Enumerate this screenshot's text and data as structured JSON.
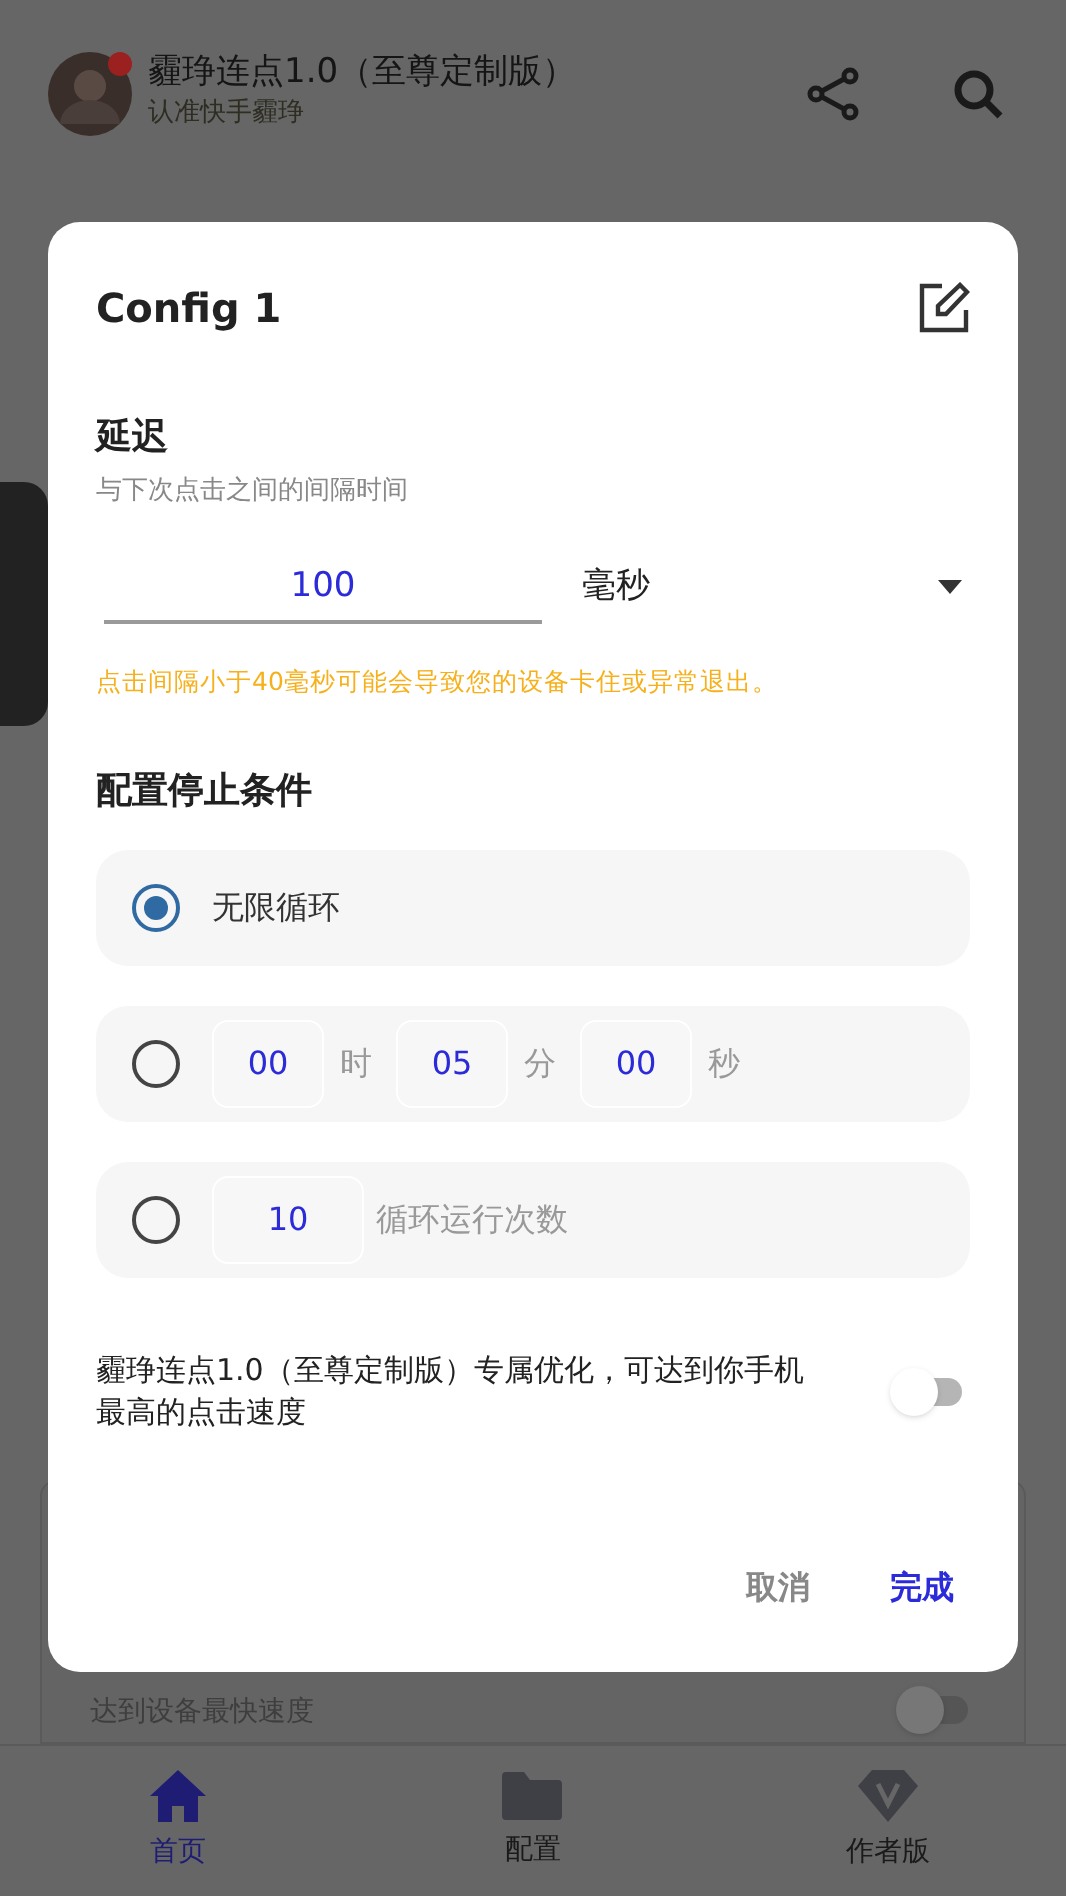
{
  "app_bar": {
    "title": "霾琤连点1.0（至尊定制版）",
    "subtitle": "认准快手霾琤"
  },
  "background_card": {
    "text": "达到设备最快速度",
    "switch_on": false
  },
  "dialog": {
    "title": "Config 1",
    "delay": {
      "heading": "延迟",
      "description": "与下次点击之间的间隔时间",
      "value": "100",
      "unit": "毫秒",
      "warning": "点击间隔小于40毫秒可能会导致您的设备卡住或异常退出。"
    },
    "stop_heading": "配置停止条件",
    "stop_options": [
      {
        "kind": "label",
        "selected": true,
        "label": "无限循环"
      },
      {
        "kind": "duration",
        "selected": false,
        "fields": [
          {
            "value": "00",
            "unit": "时"
          },
          {
            "value": "05",
            "unit": "分"
          },
          {
            "value": "00",
            "unit": "秒"
          }
        ]
      },
      {
        "kind": "count",
        "selected": false,
        "value": "10",
        "label": "循环运行次数"
      }
    ],
    "optimization": {
      "text": "霾琤连点1.0（至尊定制版）专属优化，可达到你手机最高的点击速度",
      "on": false
    },
    "buttons": [
      {
        "kind": "cancel",
        "label": "取消"
      },
      {
        "kind": "confirm",
        "label": "完成"
      }
    ]
  },
  "bottom_nav": [
    {
      "label": "首页",
      "selected": true
    },
    {
      "label": "配置",
      "selected": false
    },
    {
      "label": "作者版",
      "selected": false
    }
  ]
}
